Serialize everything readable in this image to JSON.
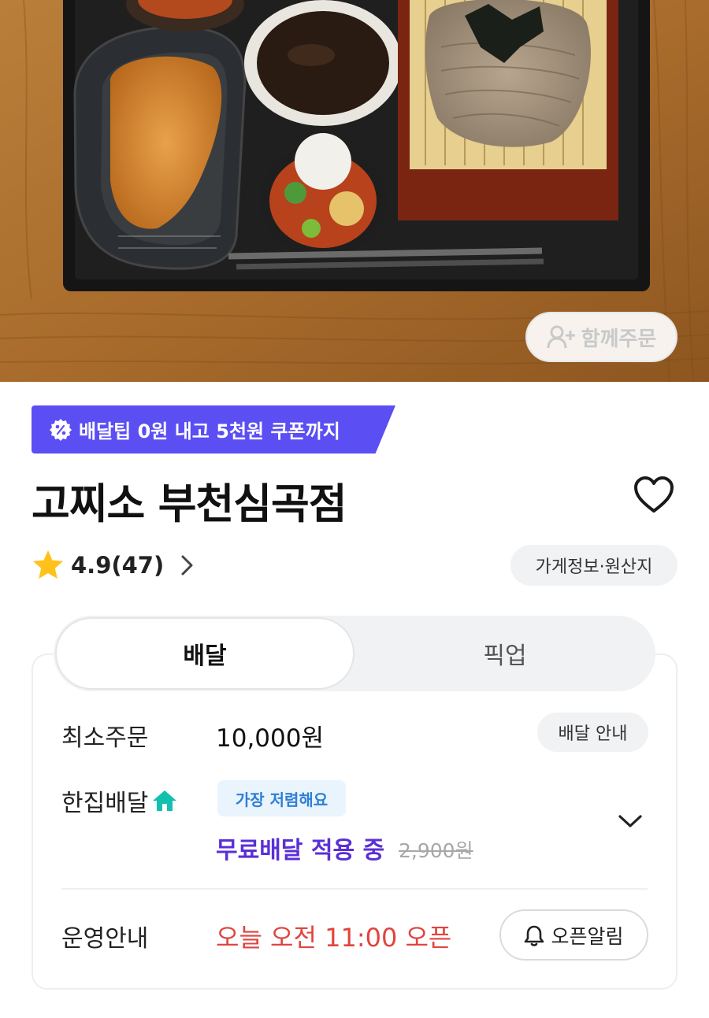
{
  "hero": {
    "group_order_label": "함께주문"
  },
  "coupon_banner": {
    "text": "배달팁 0원 내고 5천원 쿠폰까지",
    "color": "#5b4ef3"
  },
  "store": {
    "name": "고찌소 부천심곡점"
  },
  "rating": {
    "value_text": "4.9(47)"
  },
  "store_info_label": "가게정보·원산지",
  "tabs": [
    {
      "label": "배달",
      "selected": true
    },
    {
      "label": "픽업",
      "selected": false
    }
  ],
  "delivery": {
    "min_order_label": "최소주문",
    "min_order_value": "10,000원",
    "guide_button": "배달 안내",
    "hanjip_label": "한집배달",
    "cheapest_badge": "가장 저렴해요",
    "free_delivery_text": "무료배달 적용 중",
    "original_fee": "2,900원"
  },
  "operation": {
    "label": "운영안내",
    "status": "오늘 오전 11:00 오픈",
    "alarm_button": "오픈알림"
  },
  "colors": {
    "accent_purple": "#5b2fd6",
    "open_red": "#e0453f",
    "badge_blue": "#2e7fd6",
    "house_teal": "#12c0b0"
  }
}
